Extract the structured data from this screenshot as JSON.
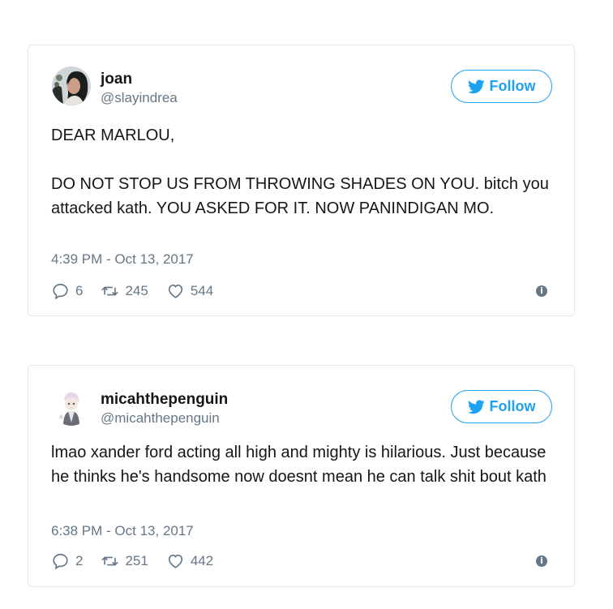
{
  "tweets": [
    {
      "name": "joan",
      "handle": "@slayindrea",
      "follow_label": "Follow",
      "text": "DEAR MARLOU,\n\nDO NOT STOP US FROM THROWING SHADES ON YOU. bitch you attacked kath. YOU ASKED FOR IT. NOW PANINDIGAN MO.",
      "timestamp": "4:39 PM - Oct 13, 2017",
      "replies": "6",
      "retweets": "245",
      "likes": "544"
    },
    {
      "name": "micahthepenguin",
      "handle": "@micahthepenguin",
      "follow_label": "Follow",
      "text": "lmao xander ford acting all high and mighty is hilarious. Just because he thinks he's handsome now doesnt mean he can talk shit bout kath",
      "timestamp": "6:38 PM - Oct 13, 2017",
      "replies": "2",
      "retweets": "251",
      "likes": "442"
    }
  ],
  "colors": {
    "accent": "#1da1f2",
    "secondary_text": "#657786",
    "border": "#e1e8ed"
  },
  "icons": [
    "twitter-bird-icon",
    "reply-icon",
    "retweet-icon",
    "heart-icon",
    "info-icon"
  ]
}
